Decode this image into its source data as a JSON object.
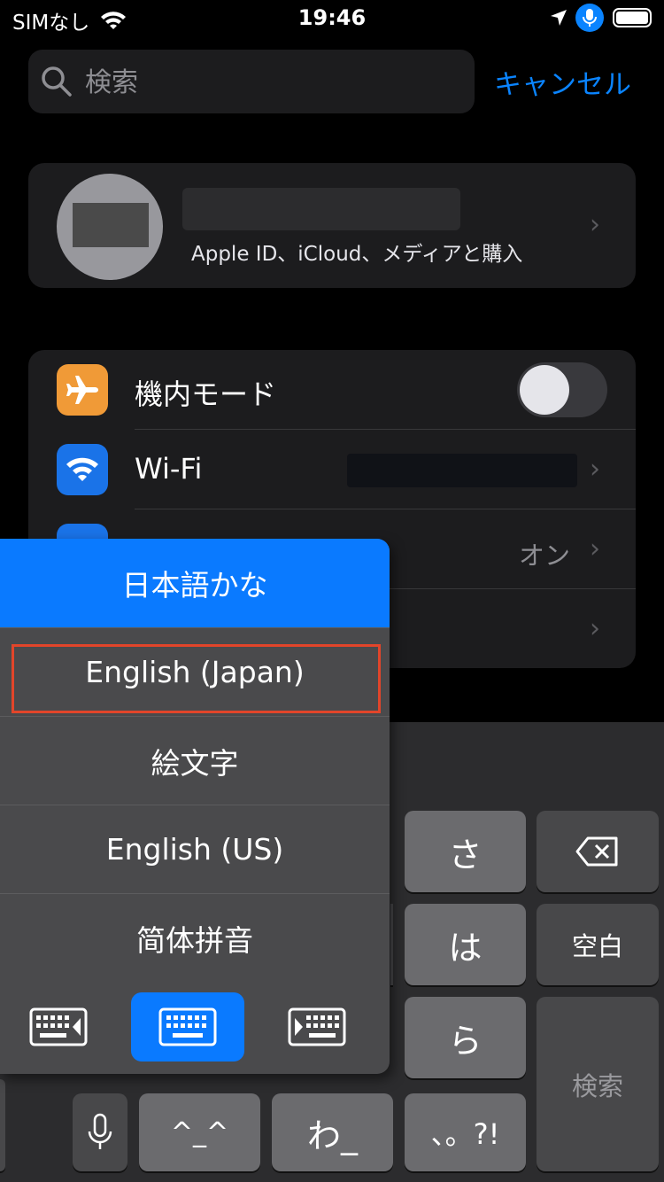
{
  "status_bar": {
    "carrier": "SIMなし",
    "time": "19:46"
  },
  "search": {
    "placeholder": "検索",
    "value": "",
    "cancel_label": "キャンセル"
  },
  "apple_id": {
    "subtitle": "Apple ID、iCloud、メディアと購入"
  },
  "settings": {
    "airplane_label": "機内モード",
    "wifi_label": "Wi-Fi",
    "bluetooth_detail": "オン"
  },
  "keyboard_menu": {
    "items": [
      "日本語かな",
      "English (Japan)",
      "絵文字",
      "English (US)",
      "简体拼音"
    ],
    "selected_index": 0,
    "highlighted_index": 1
  },
  "keyboard": {
    "sa": "さ",
    "ha": "は",
    "ra": "ら",
    "space": "空白",
    "search": "検索",
    "kaomoji": "^_^",
    "wa": "わ_",
    "punct": "、。?!"
  },
  "colors": {
    "accent": "#0a84ff",
    "highlight_border": "#e2452a",
    "airplane": "#f09a37",
    "wifi": "#1a73e8"
  }
}
